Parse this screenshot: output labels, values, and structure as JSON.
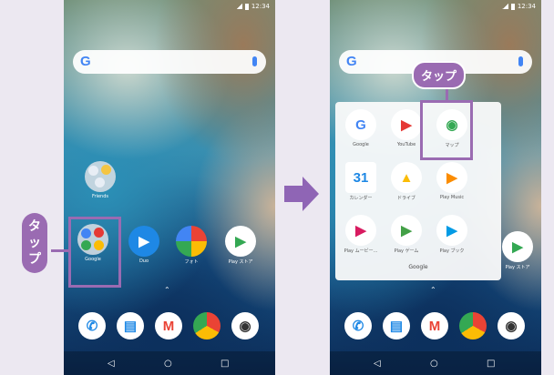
{
  "left_phone": {
    "status_time": "12:34",
    "search_logo": "G",
    "apps": {
      "friends": "Friends",
      "google": "Google",
      "duo": "Duo",
      "photos": "フォト",
      "play_store": "Play ストア"
    }
  },
  "right_phone": {
    "status_time": "12:34",
    "search_logo": "G",
    "folder_title": "Google",
    "folder_apps": [
      "Google",
      "YouTube",
      "マップ",
      "カレンダー",
      "ドライブ",
      "Play Music",
      "Play ムービー...",
      "Play ゲーム",
      "Play ブック"
    ],
    "play_store": "Play ストア"
  },
  "annotations": {
    "tap_vertical": [
      "タ",
      "ッ",
      "プ"
    ],
    "tap_label": "タップ"
  },
  "colors": {
    "accent": "#9a6bb2",
    "arrow": "#8f65b5"
  }
}
